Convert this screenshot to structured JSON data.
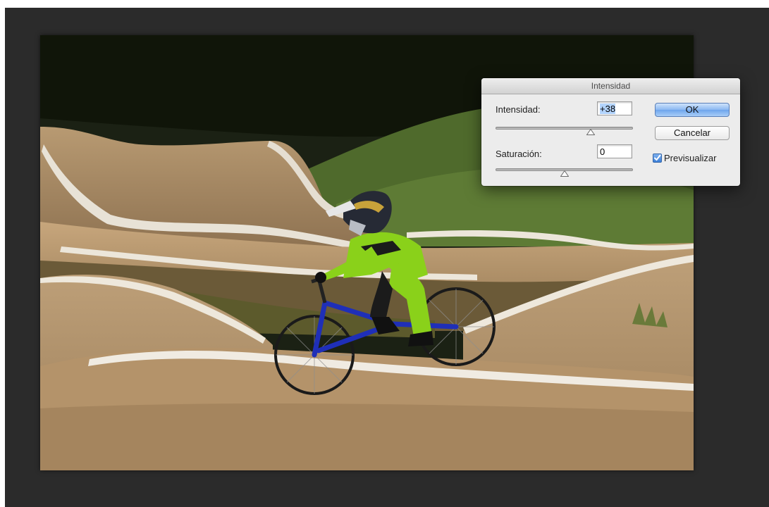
{
  "dialog": {
    "title": "Intensidad",
    "vibrance": {
      "label": "Intensidad:",
      "value": "+38",
      "slider_level": 0.69
    },
    "saturation": {
      "label": "Saturación:",
      "value": "0",
      "slider_level": 0.5
    },
    "ok_label": "OK",
    "cancel_label": "Cancelar",
    "preview": {
      "label": "Previsualizar",
      "checked": true
    }
  },
  "colors": {
    "workspace": "#2b2b2b",
    "dialog_bg": "#ececec",
    "default_button": "#7fb0ef"
  },
  "icons": {
    "thumb": "triangle-up-icon",
    "check": "checkmark-icon"
  }
}
